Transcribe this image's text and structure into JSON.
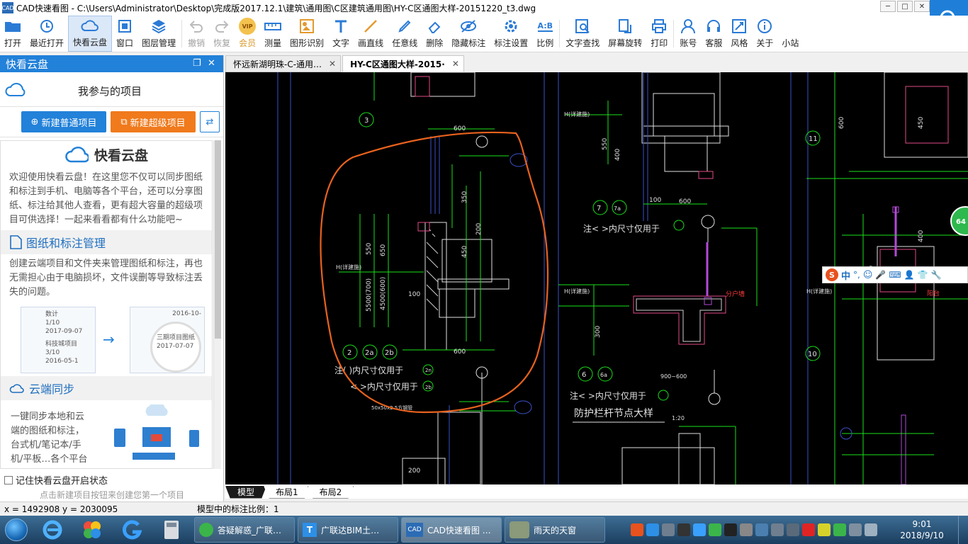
{
  "window": {
    "title": "CAD快速看图 - C:\\Users\\Administrator\\Desktop\\完成版2017.12.1\\建筑\\通用图\\C区建筑通用图\\HY-C区通图大样-20151220_t3.dwg"
  },
  "toolbar": {
    "items": [
      {
        "label": "打开",
        "icon": "folder-icon"
      },
      {
        "label": "最近打开",
        "icon": "history-icon"
      },
      {
        "label": "快看云盘",
        "icon": "cloud-icon"
      },
      {
        "label": "窗口",
        "icon": "window-icon"
      },
      {
        "label": "图层管理",
        "icon": "layers-icon"
      },
      {
        "label": "撤销",
        "icon": "undo-icon"
      },
      {
        "label": "恢复",
        "icon": "redo-icon"
      },
      {
        "label": "会员",
        "icon": "vip-icon"
      },
      {
        "label": "测量",
        "icon": "ruler-icon"
      },
      {
        "label": "图形识别",
        "icon": "shape-recognize-icon"
      },
      {
        "label": "文字",
        "icon": "text-icon"
      },
      {
        "label": "画直线",
        "icon": "line-icon"
      },
      {
        "label": "任意线",
        "icon": "pen-icon"
      },
      {
        "label": "删除",
        "icon": "eraser-icon"
      },
      {
        "label": "隐藏标注",
        "icon": "eye-hide-icon"
      },
      {
        "label": "标注设置",
        "icon": "settings-icon"
      },
      {
        "label": "比例",
        "icon": "scale-icon"
      },
      {
        "label": "文字查找",
        "icon": "text-search-icon"
      },
      {
        "label": "屏幕旋转",
        "icon": "rotate-icon"
      },
      {
        "label": "打印",
        "icon": "printer-icon"
      },
      {
        "label": "账号",
        "icon": "user-icon"
      },
      {
        "label": "客服",
        "icon": "headset-icon"
      },
      {
        "label": "风格",
        "icon": "style-icon"
      },
      {
        "label": "关于",
        "icon": "info-icon"
      },
      {
        "label": "小站",
        "icon": "search-icon"
      }
    ],
    "vip_badge": "VIP",
    "scale_badge": "A:B"
  },
  "panel": {
    "title": "快看云盘",
    "my_projects": "我参与的项目",
    "new_normal_project": "新建普通项目",
    "new_super_project": "新建超级项目",
    "brand": "快看云盘",
    "intro": "欢迎使用快看云盘！在这里您不仅可以同步图纸和标注到手机、电脑等各个平台，还可以分享图纸、标注给其他人查看，更有超大容量的超级项目可供选择！一起来看看都有什么功能吧~",
    "section1_title": "图纸和标注管理",
    "section1_text": "创建云端项目和文件夹来管理图纸和标注，再也无需担心由于电脑损坏，文件误删等导致标注丢失的问题。",
    "illus_items": [
      {
        "name": "数计",
        "meta": "1/10",
        "date": "2017-09-07"
      },
      {
        "name": "科技城项目",
        "meta": "3/10",
        "date": "2016-05-1"
      },
      {
        "name": "三期项目图纸",
        "meta": "",
        "date": "2017-07-07"
      },
      {
        "name": "",
        "meta": "",
        "date": "2016-10-"
      }
    ],
    "section2_title": "云端同步",
    "section2_text": "一键同步本地和云端的图纸和标注，台式机/笔记本/手机/平板…各个平台图纸标",
    "remember_label": "记住快看云盘开启状态",
    "hint": "点击新建项目按钮来创建您第一个项目"
  },
  "tabs": [
    {
      "label": "怀远新湖明珠-C-通用…",
      "active": false
    },
    {
      "label": "HY-C区通图大样-2015·",
      "active": true
    }
  ],
  "drawing": {
    "dims": [
      "600",
      "600",
      "600",
      "550",
      "650",
      "450",
      "100",
      "5500(700)",
      "4500(600)",
      "350",
      "200",
      "550",
      "100",
      "450",
      "50",
      "600",
      "900",
      "400",
      "100",
      "600",
      "450",
      "200",
      "300",
      "400",
      "550",
      "900~600",
      "1:20"
    ],
    "circles": [
      "3",
      "2",
      "2a",
      "2b",
      "7",
      "7a",
      "6",
      "6a",
      "11",
      "10",
      "2b",
      "2n"
    ],
    "notes": [
      "注( )内尺寸仅用于",
      "< >内尺寸仅用于",
      "注< >内尺寸仅用于",
      "注< >内尺寸仅用于",
      "防护栏杆节点大样",
      "50x50x2.5方钢管",
      "H(详建施)",
      "H(详建施)",
      "H(详建施)",
      "分户墙",
      "阳台"
    ],
    "green_badge": "64"
  },
  "layout_tabs": [
    {
      "label": "模型",
      "active": true
    },
    {
      "label": "布局1",
      "active": false
    },
    {
      "label": "布局2",
      "active": false
    }
  ],
  "status": {
    "coords": "x = 1492908  y = 2030095",
    "scale": "模型中的标注比例：1"
  },
  "taskbar": {
    "tasks": [
      {
        "label": "答疑解惑_广联…"
      },
      {
        "label": "广联达BIM土…"
      },
      {
        "label": "CAD快速看图 …"
      },
      {
        "label": "雨天的天窗"
      }
    ],
    "time": "9:01",
    "date": "2018/9/10"
  },
  "ime": {
    "label": "中"
  },
  "colors": {
    "accent": "#2281d9",
    "orange": "#f07a1c",
    "cad_bg": "#000000",
    "markup": "#e8621e"
  }
}
